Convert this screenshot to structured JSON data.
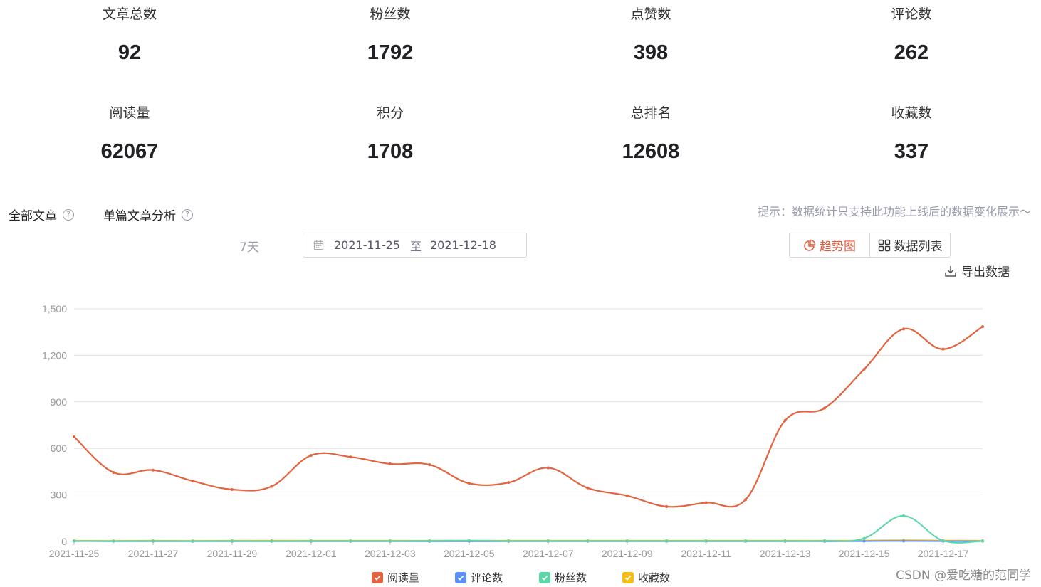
{
  "stats": [
    {
      "label": "文章总数",
      "value": "92"
    },
    {
      "label": "粉丝数",
      "value": "1792"
    },
    {
      "label": "点赞数",
      "value": "398"
    },
    {
      "label": "评论数",
      "value": "262"
    },
    {
      "label": "阅读量",
      "value": "62067"
    },
    {
      "label": "积分",
      "value": "1708"
    },
    {
      "label": "总排名",
      "value": "12608"
    },
    {
      "label": "收藏数",
      "value": "337"
    }
  ],
  "tabs": {
    "all": "全部文章",
    "single": "单篇文章分析"
  },
  "tip": "提示：数据统计只支持此功能上线后的数据变化展示～",
  "range": {
    "label": "7天",
    "start": "2021-11-25",
    "sep": "至",
    "end": "2021-12-18"
  },
  "view": {
    "trend": "趋势图",
    "list": "数据列表"
  },
  "export_label": "导出数据",
  "watermark": "CSDN @爱吃糖的范同学",
  "icons": {
    "help": "help-circle-icon",
    "calendar": "calendar-icon",
    "trend": "pie-chart-icon",
    "list": "grid-icon",
    "export": "download-icon",
    "check": "check-icon"
  },
  "chart_data": {
    "type": "line",
    "x": [
      "2021-11-25",
      "2021-11-26",
      "2021-11-27",
      "2021-11-28",
      "2021-11-29",
      "2021-11-30",
      "2021-12-01",
      "2021-12-02",
      "2021-12-03",
      "2021-12-04",
      "2021-12-05",
      "2021-12-06",
      "2021-12-07",
      "2021-12-08",
      "2021-12-09",
      "2021-12-10",
      "2021-12-11",
      "2021-12-12",
      "2021-12-13",
      "2021-12-14",
      "2021-12-15",
      "2021-12-16",
      "2021-12-17",
      "2021-12-18"
    ],
    "x_tick_labels": [
      "2021-11-25",
      "2021-11-27",
      "2021-11-29",
      "2021-12-01",
      "2021-12-03",
      "2021-12-05",
      "2021-12-07",
      "2021-12-09",
      "2021-12-11",
      "2021-12-13",
      "2021-12-15",
      "2021-12-17"
    ],
    "ylim": [
      0,
      1500
    ],
    "y_ticks": [
      0,
      300,
      600,
      900,
      1200,
      1500
    ],
    "y_tick_labels": [
      "0",
      "300",
      "600",
      "900",
      "1,200",
      "1,500"
    ],
    "grid": true,
    "legend_position": "bottom",
    "series": [
      {
        "name": "阅读量",
        "color": "#e4633f",
        "values": [
          675,
          445,
          460,
          390,
          335,
          355,
          555,
          545,
          500,
          495,
          375,
          380,
          475,
          345,
          295,
          225,
          250,
          270,
          780,
          860,
          1110,
          1370,
          1240,
          1385
        ]
      },
      {
        "name": "评论数",
        "color": "#5b8ff9",
        "values": [
          2,
          1,
          1,
          1,
          1,
          1,
          1,
          1,
          1,
          1,
          1,
          1,
          1,
          1,
          1,
          1,
          1,
          1,
          1,
          1,
          2,
          3,
          2,
          2
        ]
      },
      {
        "name": "粉丝数",
        "color": "#5ad8a6",
        "values": [
          3,
          2,
          3,
          2,
          3,
          2,
          3,
          3,
          3,
          4,
          6,
          3,
          3,
          3,
          3,
          3,
          3,
          3,
          3,
          4,
          20,
          165,
          5,
          3
        ]
      },
      {
        "name": "收藏数",
        "color": "#f6bd16",
        "values": [
          5,
          4,
          5,
          4,
          5,
          5,
          5,
          5,
          5,
          5,
          5,
          5,
          5,
          5,
          5,
          5,
          5,
          5,
          5,
          5,
          6,
          8,
          6,
          5
        ]
      }
    ]
  }
}
